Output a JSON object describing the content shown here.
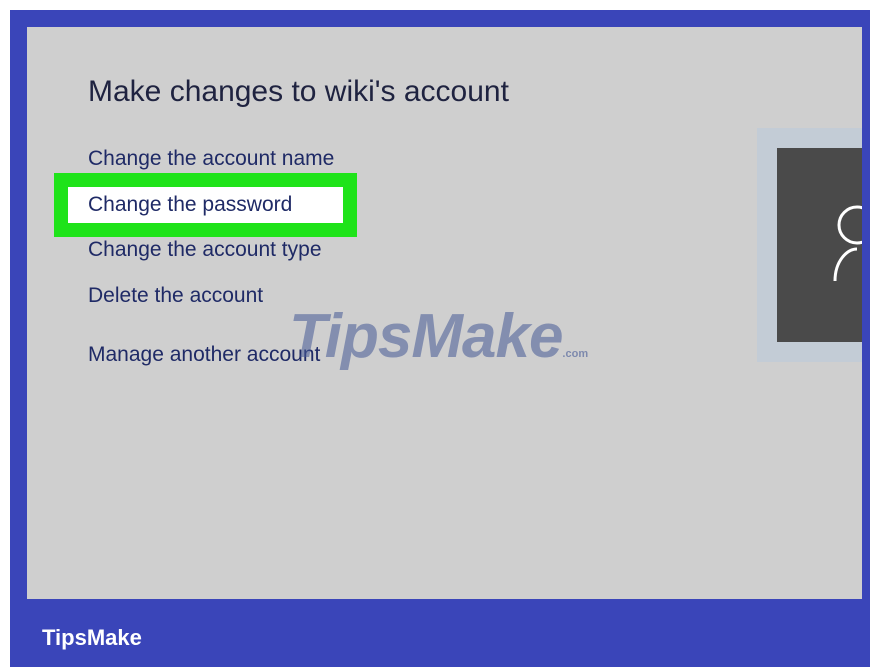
{
  "dialog": {
    "title": "Make changes to wiki's account",
    "links": [
      "Change the account name",
      "Change the password",
      "Change the account type",
      "Delete the account",
      "Manage another account"
    ],
    "highlighted_link": "Change the password"
  },
  "avatar": {
    "icon": "user-icon"
  },
  "watermark": {
    "text": "TipsMake",
    "suffix": ".com"
  },
  "footer": {
    "brand": "TipsMake"
  },
  "colors": {
    "frame": "#3a45b9",
    "panel": "#cfcfcf",
    "highlight_border": "#1fe31a",
    "link_text": "#1f2a66",
    "avatar_box": "#4a4a4a"
  }
}
